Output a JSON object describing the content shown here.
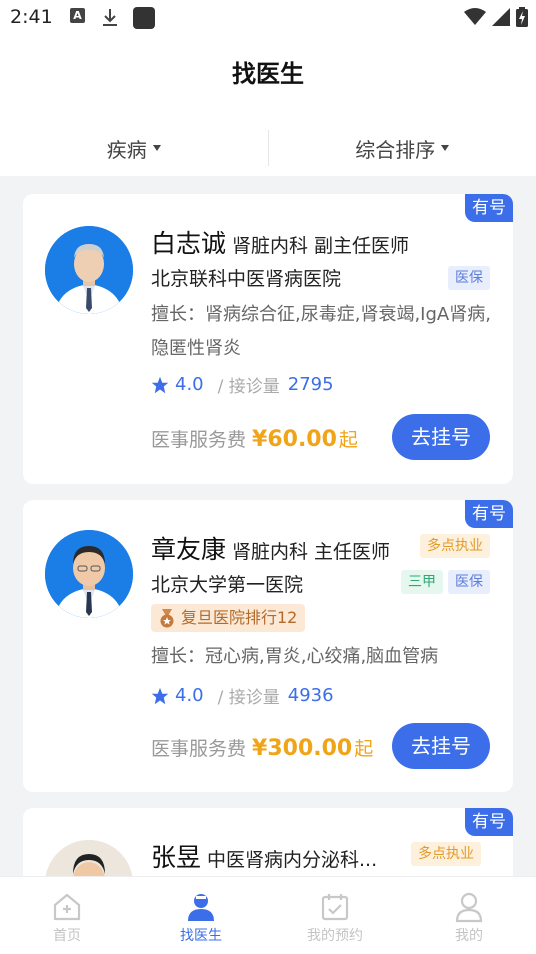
{
  "status_bar": {
    "time": "2:41",
    "icons": [
      "a-icon",
      "download-icon",
      "app-icon",
      "wifi-icon",
      "signal-icon",
      "battery-icon"
    ]
  },
  "header": {
    "title": "找医生"
  },
  "filters": [
    {
      "label": "疾病"
    },
    {
      "label": "综合排序"
    }
  ],
  "doctors": [
    {
      "availability": "有号",
      "name": "白志诚",
      "dept_title": "肾脏内科 副主任医师",
      "tags": [],
      "hospital": "北京联科中医肾病医院",
      "hospital_tags": [
        "医保"
      ],
      "specialty": "擅长：肾病综合征,尿毒症,肾衰竭,IgA肾病,隐匿性肾炎",
      "rating": "4.0",
      "visits_label": "/ 接诊量",
      "visits": "2795",
      "fee_label": "医事服务费",
      "fee": "¥60.00",
      "fee_suffix": "起",
      "button": "去挂号"
    },
    {
      "availability": "有号",
      "name": "章友康",
      "dept_title": "肾脏内科 主任医师",
      "tags": [
        "多点执业"
      ],
      "hospital": "北京大学第一医院",
      "hospital_tags": [
        "三甲",
        "医保"
      ],
      "rank_badge": "复旦医院排行12",
      "specialty": "擅长：冠心病,胃炎,心绞痛,脑血管病",
      "rating": "4.0",
      "visits_label": "/ 接诊量",
      "visits": "4936",
      "fee_label": "医事服务费",
      "fee": "¥300.00",
      "fee_suffix": "起",
      "button": "去挂号"
    },
    {
      "availability": "有号",
      "name": "张昱",
      "dept_title": "中医肾病内分泌科...",
      "tags": [
        "多点执业"
      ]
    }
  ],
  "tabbar": [
    {
      "label": "首页",
      "icon": "home-icon",
      "active": false
    },
    {
      "label": "找医生",
      "icon": "doctor-icon",
      "active": true
    },
    {
      "label": "我的预约",
      "icon": "calendar-check-icon",
      "active": false
    },
    {
      "label": "我的",
      "icon": "user-icon",
      "active": false
    }
  ],
  "colors": {
    "accent": "#3b6ee8",
    "fee": "#f0a418",
    "background": "#f2f3f5"
  }
}
